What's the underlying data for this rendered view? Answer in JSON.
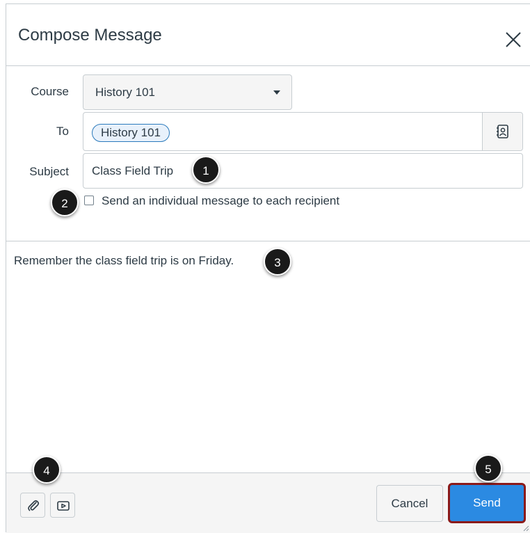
{
  "dialog": {
    "title": "Compose Message",
    "close_icon": "close-icon"
  },
  "form": {
    "course_label": "Course",
    "course_value": "History 101",
    "to_label": "To",
    "recipient_token": "History 101",
    "address_book_icon": "address-book-icon",
    "subject_label": "Subject",
    "subject_value": "Class Field Trip",
    "individual_message_label": "Send an individual message to each recipient",
    "individual_message_checked": false
  },
  "message": {
    "body": "Remember the class field trip is on Friday."
  },
  "footer": {
    "attach_icon": "paperclip-icon",
    "media_icon": "media-icon",
    "cancel_label": "Cancel",
    "send_label": "Send"
  },
  "callouts": [
    "1",
    "2",
    "3",
    "4",
    "5"
  ],
  "colors": {
    "send_button": "#2b8ae2",
    "send_highlight_border": "#8b1a1a",
    "token_border": "#2b7abc",
    "callout": "#1a1a1a"
  }
}
